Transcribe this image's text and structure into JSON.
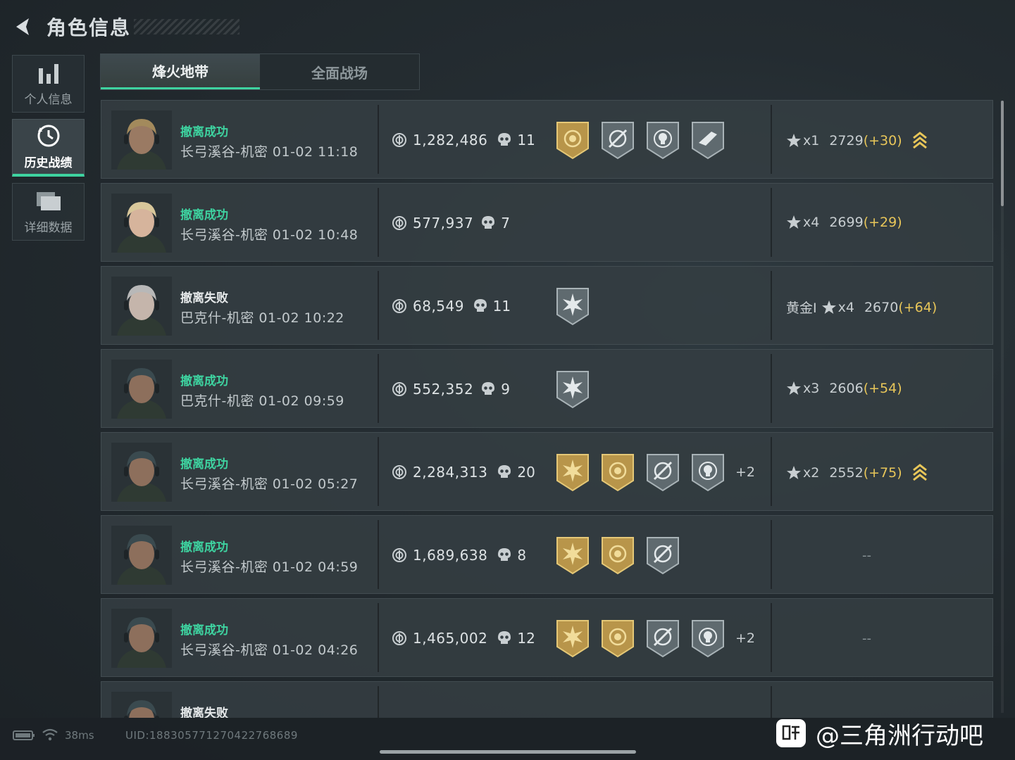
{
  "header": {
    "title": "角色信息"
  },
  "sidenav": [
    {
      "label": "个人信息",
      "icon": "bar-chart-icon"
    },
    {
      "label": "历史战绩",
      "icon": "clock-history-icon",
      "active": true
    },
    {
      "label": "详细数据",
      "icon": "folder-icon"
    }
  ],
  "tabs": [
    {
      "label": "烽火地带",
      "active": true
    },
    {
      "label": "全面战场",
      "active": false
    }
  ],
  "matches": [
    {
      "status": "撤离成功",
      "success": true,
      "map_time": "长弓溪谷-机密 01-02 11:18",
      "money": "1,282,486",
      "kills": "11",
      "badges": [
        "gold-shield-badge",
        "silver-crosshair-badge",
        "silver-skull-badge",
        "silver-weapon-badge"
      ],
      "more": "",
      "rank_tier": "",
      "rank_mult": "x1",
      "rank_score": "2729",
      "rank_delta": "(+30)",
      "rank_up": true
    },
    {
      "status": "撤离成功",
      "success": true,
      "map_time": "长弓溪谷-机密 01-02 10:48",
      "money": "577,937",
      "kills": "7",
      "badges": [],
      "more": "",
      "rank_tier": "",
      "rank_mult": "x4",
      "rank_score": "2699",
      "rank_delta": "(+29)",
      "rank_up": false
    },
    {
      "status": "撤离失败",
      "success": false,
      "map_time": "巴克什-机密 01-02 10:22",
      "money": "68,549",
      "kills": "11",
      "badges": [
        "silver-burst-badge"
      ],
      "more": "",
      "rank_tier": "黄金I",
      "rank_mult": "x4",
      "rank_score": "2670",
      "rank_delta": "(+64)",
      "rank_up": false
    },
    {
      "status": "撤离成功",
      "success": true,
      "map_time": "巴克什-机密 01-02 09:59",
      "money": "552,352",
      "kills": "9",
      "badges": [
        "silver-burst-badge"
      ],
      "more": "",
      "rank_tier": "",
      "rank_mult": "x3",
      "rank_score": "2606",
      "rank_delta": "(+54)",
      "rank_up": false
    },
    {
      "status": "撤离成功",
      "success": true,
      "map_time": "长弓溪谷-机密 01-02 05:27",
      "money": "2,284,313",
      "kills": "20",
      "badges": [
        "gold-burst-badge",
        "gold-shield-badge",
        "silver-crosshair-badge",
        "silver-skull-badge"
      ],
      "more": "+2",
      "rank_tier": "",
      "rank_mult": "x2",
      "rank_score": "2552",
      "rank_delta": "(+75)",
      "rank_up": true
    },
    {
      "status": "撤离成功",
      "success": true,
      "map_time": "长弓溪谷-机密 01-02 04:59",
      "money": "1,689,638",
      "kills": "8",
      "badges": [
        "gold-burst-badge",
        "gold-shield-badge",
        "silver-crosshair-badge"
      ],
      "more": "",
      "rank_tier": "",
      "rank_mult": "",
      "rank_score": "",
      "rank_delta": "",
      "rank_up": false,
      "rank_empty": "--"
    },
    {
      "status": "撤离成功",
      "success": true,
      "map_time": "长弓溪谷-机密 01-02 04:26",
      "money": "1,465,002",
      "kills": "12",
      "badges": [
        "gold-burst-badge",
        "gold-shield-badge",
        "silver-crosshair-badge",
        "silver-skull-badge"
      ],
      "more": "+2",
      "rank_tier": "",
      "rank_mult": "",
      "rank_score": "",
      "rank_delta": "",
      "rank_up": false,
      "rank_empty": "--"
    },
    {
      "status": "撤离失败",
      "success": false,
      "map_time": "",
      "money": "",
      "kills": "",
      "badges": [],
      "more": "",
      "rank_tier": "",
      "rank_mult": "",
      "rank_score": "",
      "rank_delta": "",
      "rank_up": false
    }
  ],
  "footer": {
    "ping": "38ms",
    "uid": "UID:188305771270422768689"
  },
  "watermark": {
    "text": "@三角洲行动吧"
  },
  "colors": {
    "accent": "#3ed3a0",
    "gold": "#e8c659",
    "row_bg": "#343d42"
  }
}
